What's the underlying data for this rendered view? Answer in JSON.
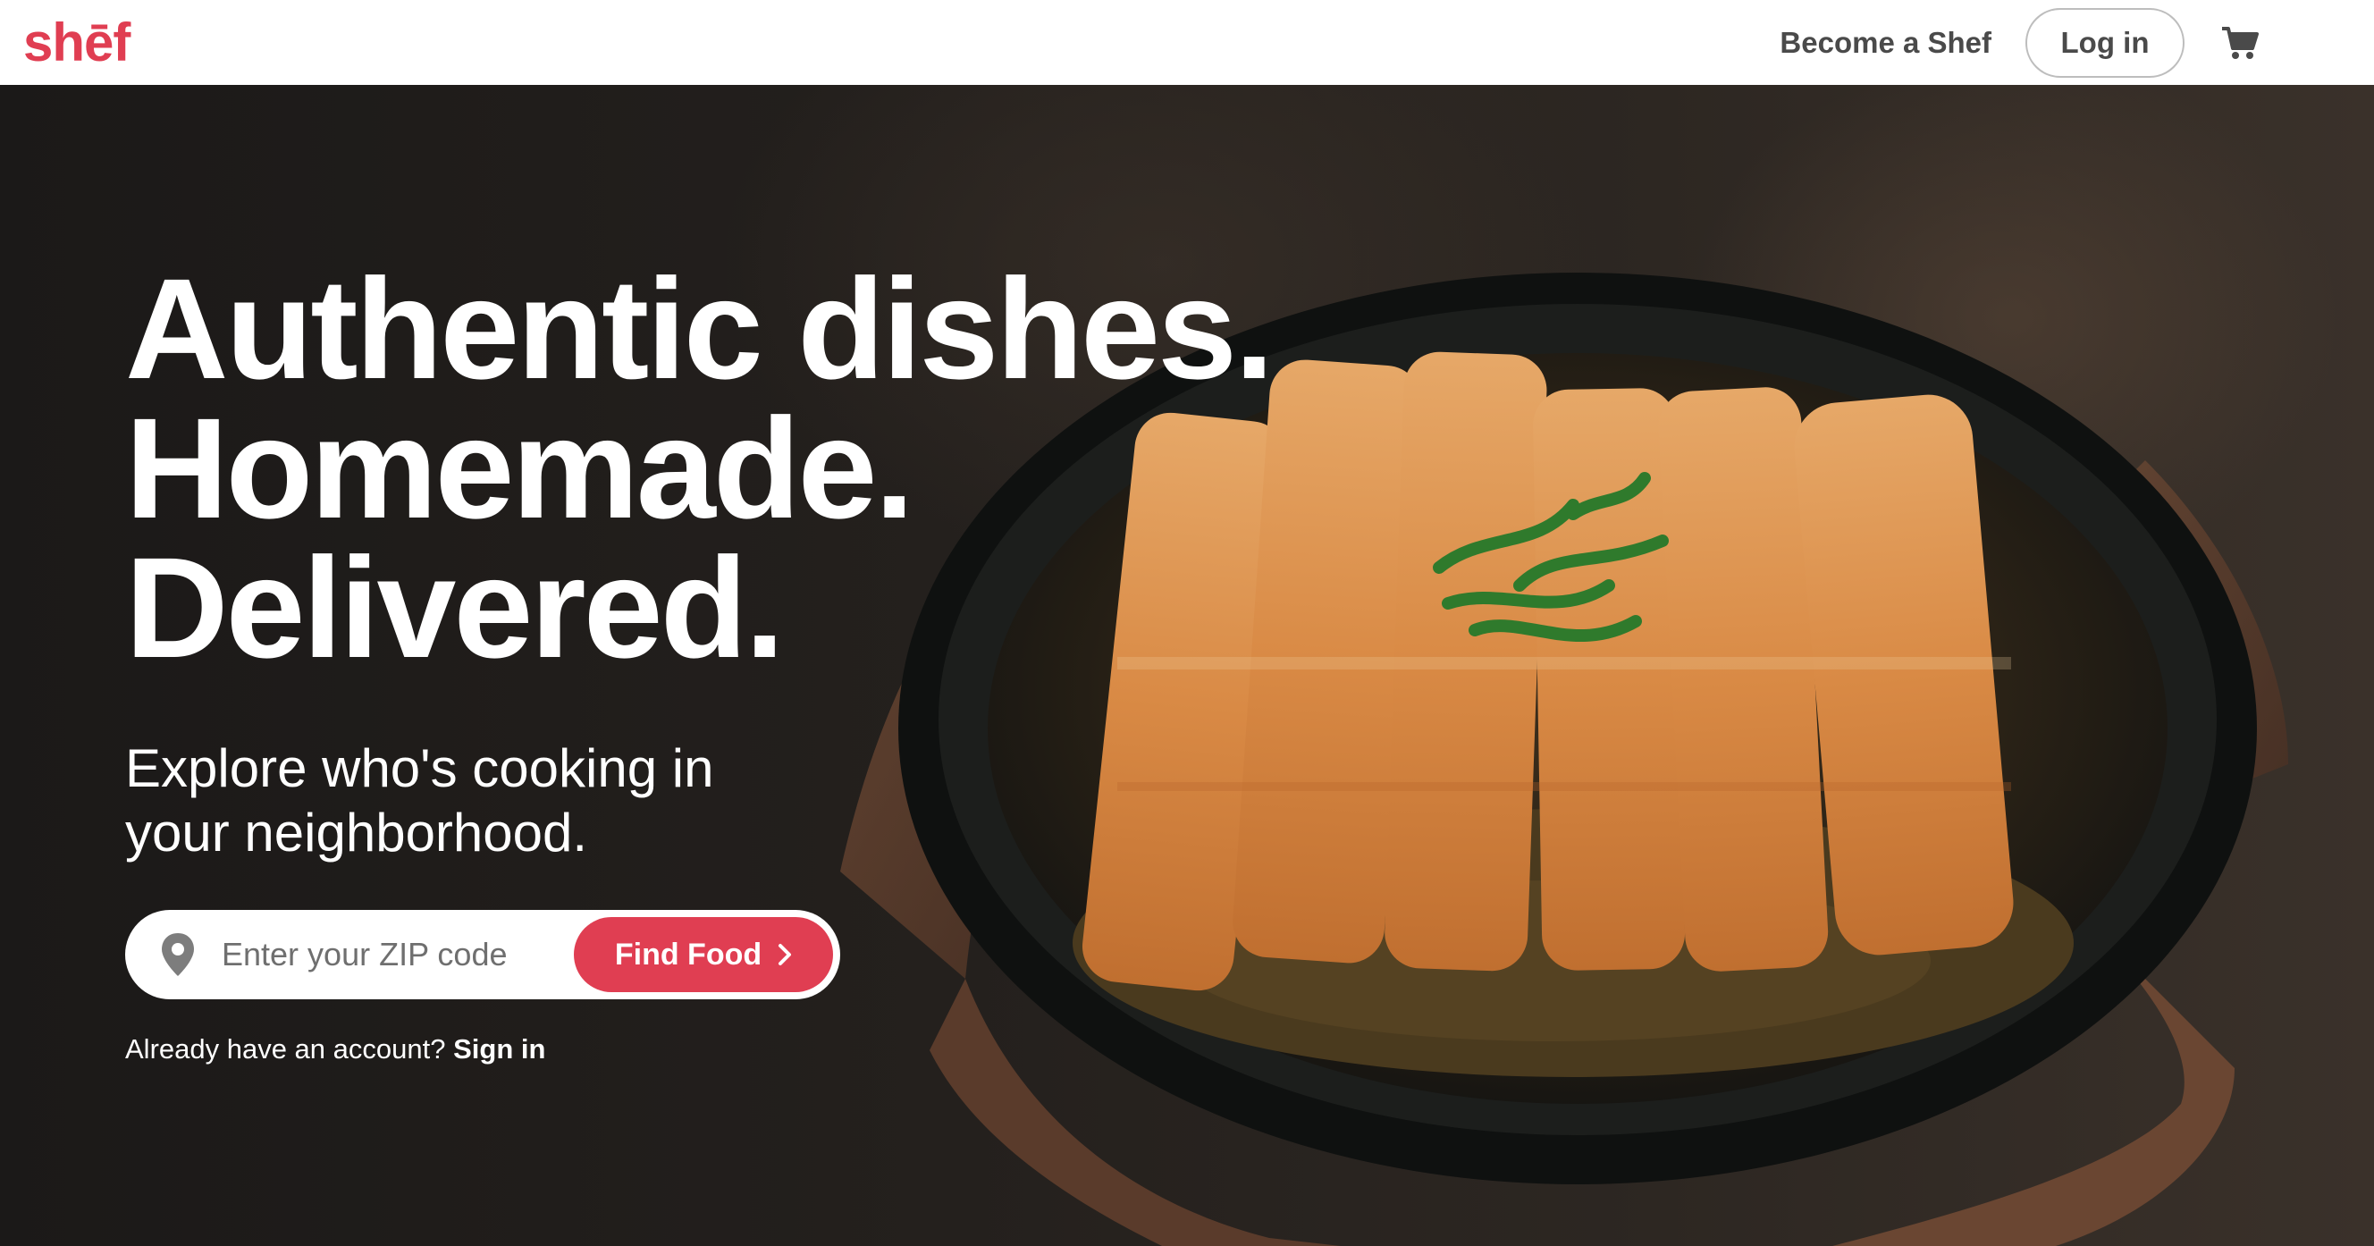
{
  "header": {
    "logo_text": "shēf",
    "become_label": "Become a Shef",
    "login_label": "Log in",
    "cart_icon": "cart-icon"
  },
  "hero": {
    "headline_line1": "Authentic dishes.",
    "headline_line2": "Homemade.",
    "headline_line3": "Delivered.",
    "subhead": "Explore who's cooking in your neighborhood.",
    "zip_placeholder": "Enter your ZIP code",
    "zip_value": "",
    "find_label": "Find Food",
    "account_prompt": "Already have an account?",
    "signin_label": "Sign in",
    "location_icon": "location-pin-icon",
    "chevron_icon": "chevron-right-icon"
  },
  "colors": {
    "brand": "#e03e52",
    "nav_text": "#4a4a4a",
    "hero_text": "#ffffff"
  }
}
